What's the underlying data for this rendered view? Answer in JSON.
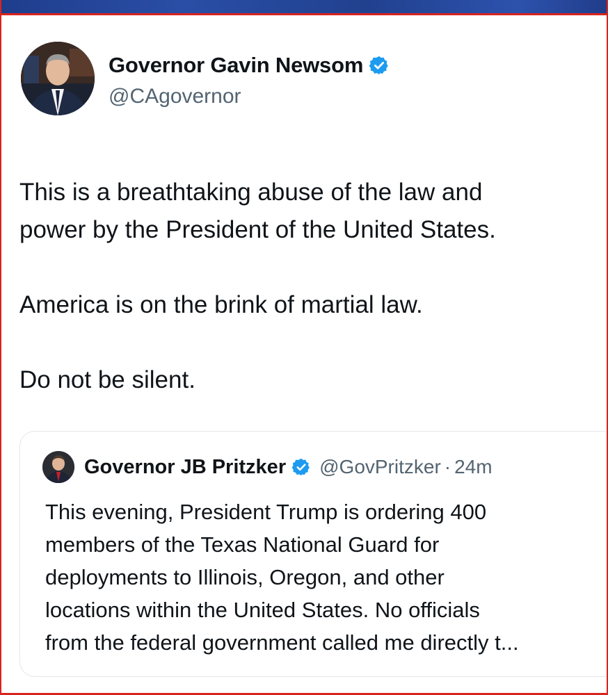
{
  "tweet": {
    "author_name": "Governor Gavin Newsom",
    "author_handle": "@CAgovernor",
    "verified_icon": "verified-badge-icon",
    "paragraphs": [
      {
        "lines": [
          "This is a breathtaking abuse of the law and",
          "power by the President of the United States."
        ]
      },
      {
        "lines": [
          "America is on the brink of martial law."
        ]
      },
      {
        "lines": [
          "Do not be silent."
        ]
      }
    ]
  },
  "quoted_tweet": {
    "author_name": "Governor JB Pritzker",
    "author_handle": "@GovPritzker",
    "separator": "·",
    "timestamp": "24m",
    "lines": [
      "This evening, President Trump is ordering 400",
      "members of the Texas National Guard for",
      "deployments to Illinois, Oregon, and other",
      "locations within the United States. No officials",
      "from the federal government called me directly t..."
    ]
  },
  "colors": {
    "verified_blue": "#1d9bf0",
    "frame_red": "#d9231f",
    "banner_blue": "#2a4ea6",
    "secondary_text": "#536471"
  }
}
